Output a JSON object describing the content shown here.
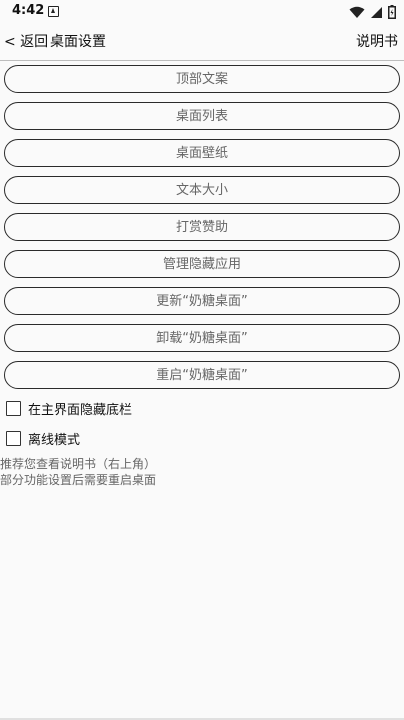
{
  "status_bar": {
    "time": "4:42",
    "icons": [
      "notification-icon",
      "wifi-icon",
      "signal-icon",
      "battery-icon"
    ]
  },
  "app_bar": {
    "back_label": "< 返回",
    "title": "桌面设置",
    "manual_label": "说明书"
  },
  "menu": {
    "items": [
      {
        "label": "顶部文案"
      },
      {
        "label": "桌面列表"
      },
      {
        "label": "桌面壁纸"
      },
      {
        "label": "文本大小"
      },
      {
        "label": "打赏赞助"
      },
      {
        "label": "管理隐藏应用"
      },
      {
        "label": "更新“奶糖桌面”"
      },
      {
        "label": "卸载“奶糖桌面”"
      },
      {
        "label": "重启“奶糖桌面”"
      }
    ]
  },
  "options": {
    "hide_bottom_bar": {
      "label": "在主界面隐藏底栏",
      "checked": false
    },
    "offline_mode": {
      "label": "离线模式",
      "checked": false
    }
  },
  "notes": {
    "line1": "推荐您查看说明书（右上角）",
    "line2": "部分功能设置后需要重启桌面"
  },
  "colors": {
    "background": "#fafafa",
    "button_border": "#2b2b2b",
    "button_text": "#666666"
  }
}
